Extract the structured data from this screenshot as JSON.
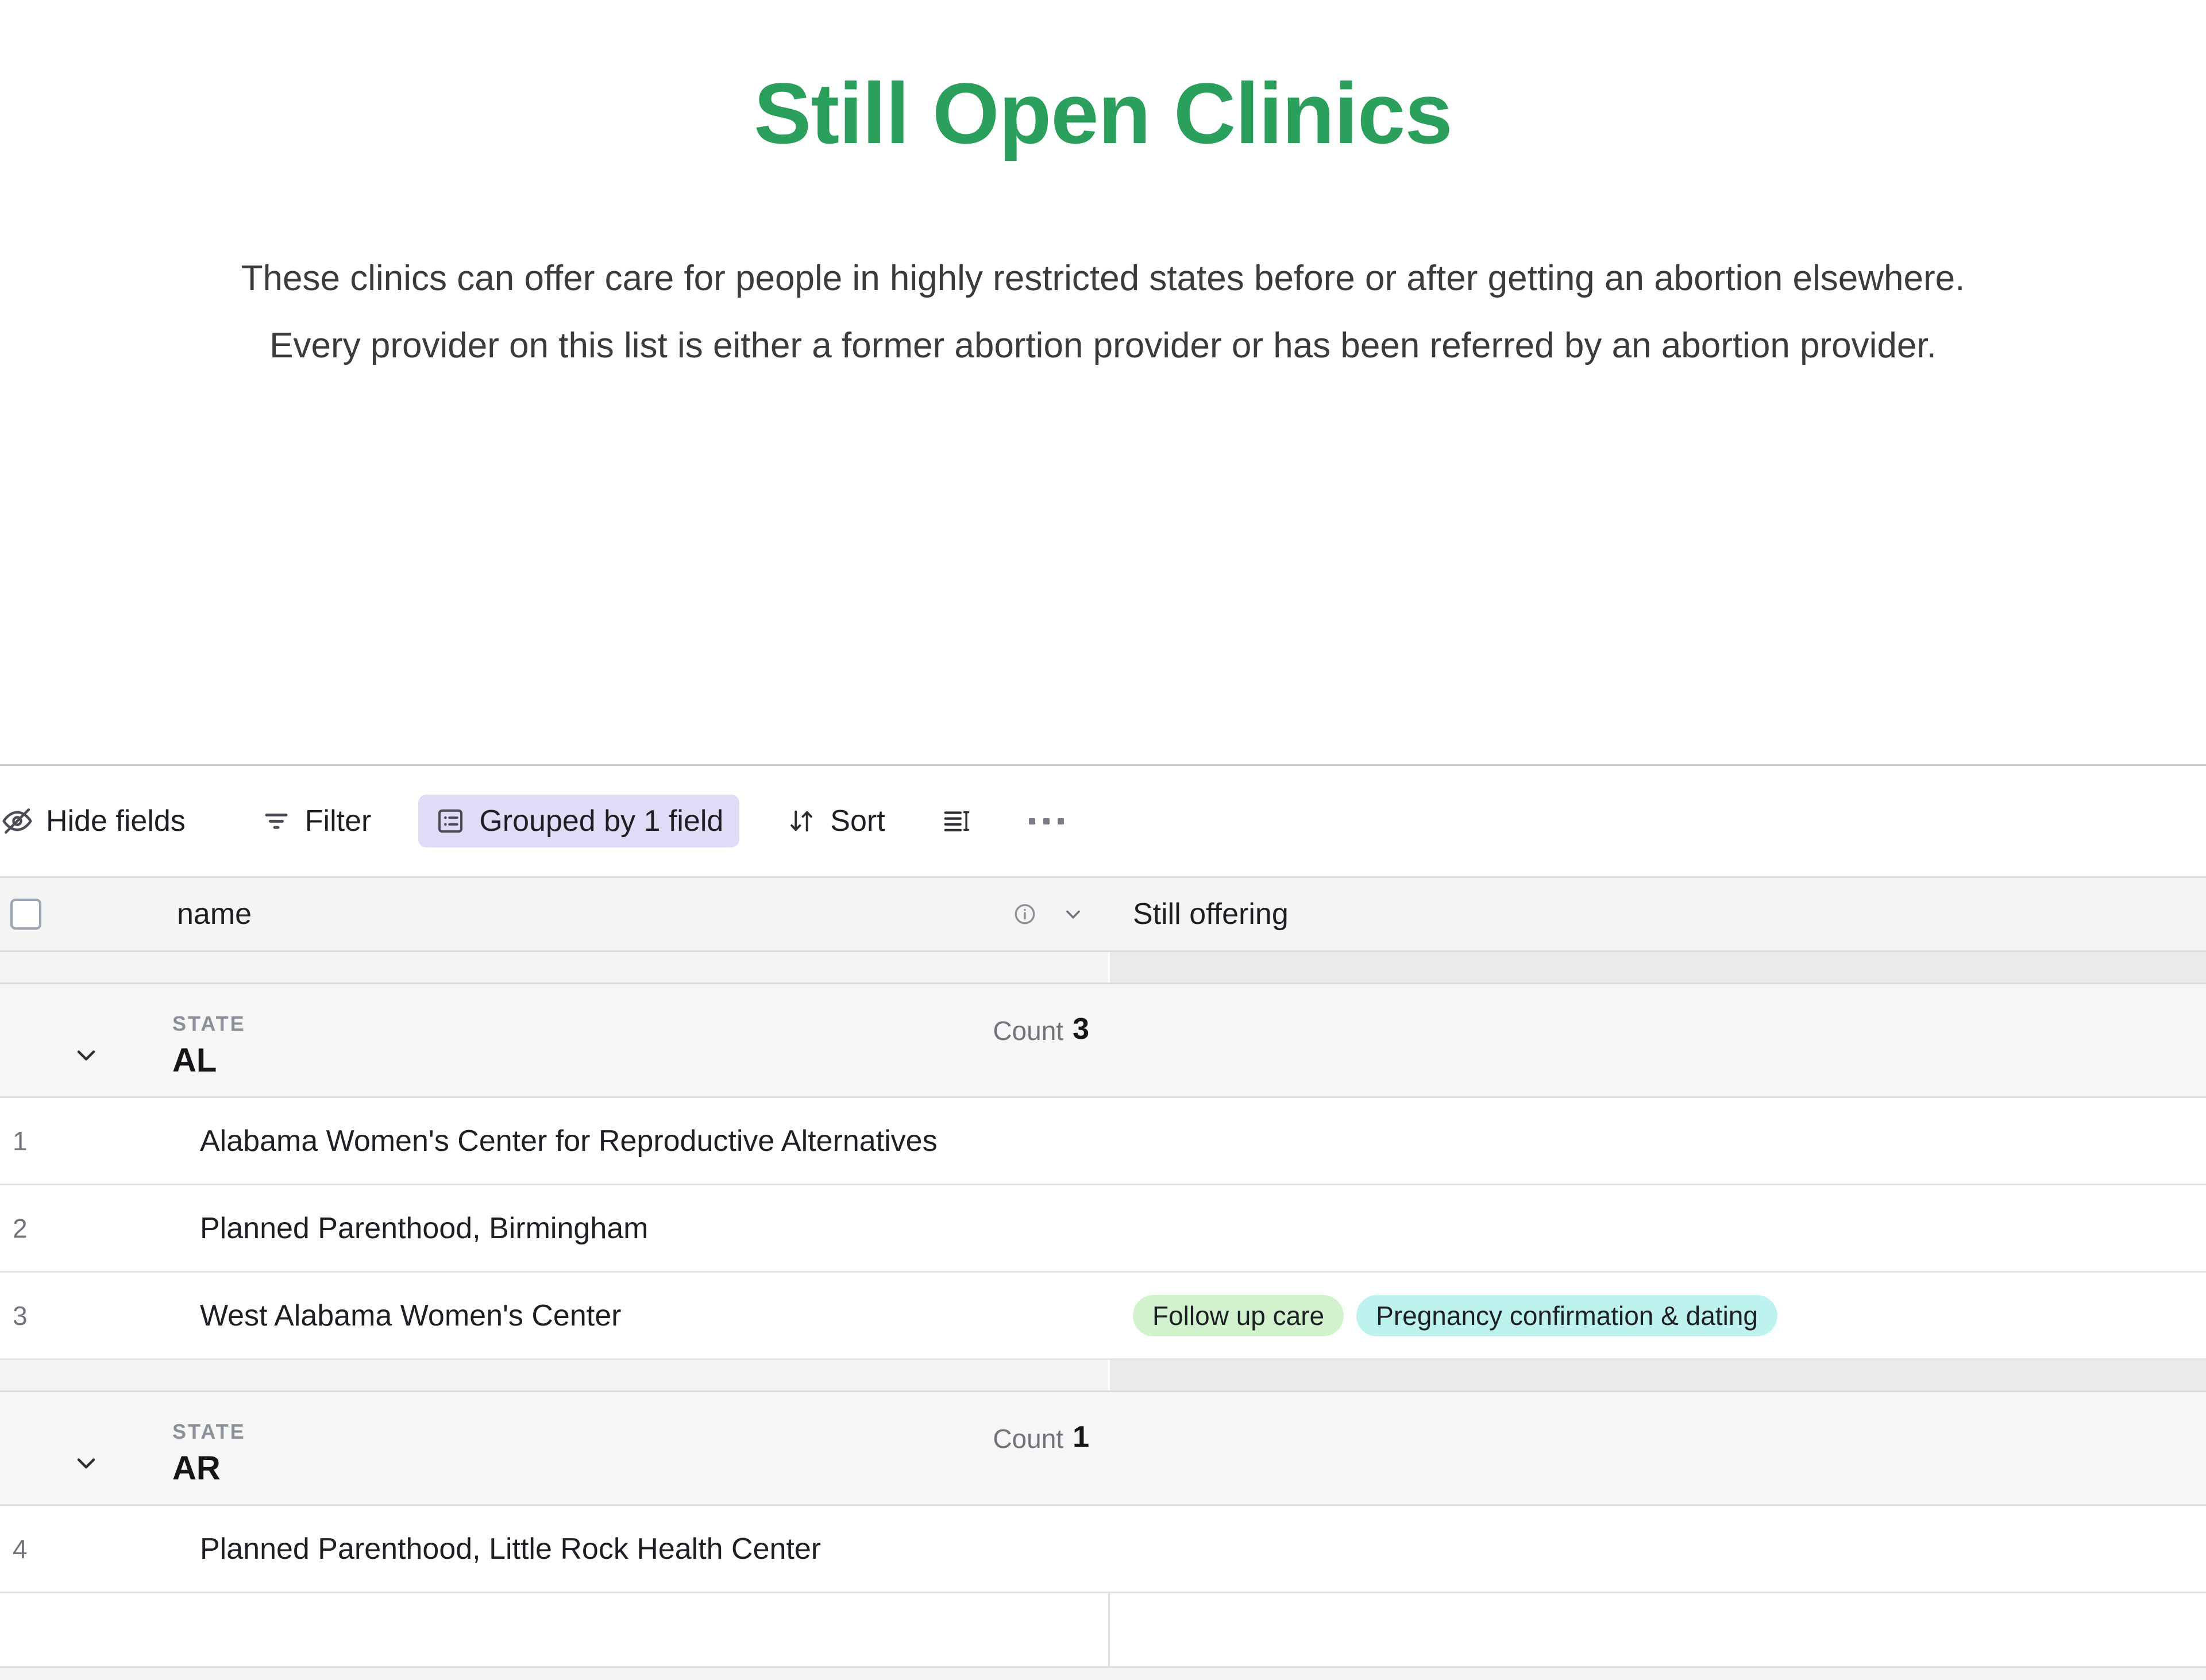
{
  "hero": {
    "title": "Still Open Clinics",
    "description": "These clinics can offer care for people in highly restricted states before or after getting an abortion elsewhere. Every provider on this list is either a former abortion provider or has been referred by an abortion provider.",
    "title_color": "#2ba05c"
  },
  "toolbar": {
    "hide_fields_label": "Hide fields",
    "filter_label": "Filter",
    "group_label": "Grouped by 1 field",
    "group_active_bg": "#e0dcf8",
    "sort_label": "Sort",
    "row_height_label": "",
    "more_label": "…"
  },
  "table": {
    "columns": [
      {
        "key": "name",
        "label": "name"
      },
      {
        "key": "still_offering",
        "label": "Still offering"
      }
    ],
    "group_field_label": "STATE",
    "count_label": "Count",
    "groups": [
      {
        "value": "AL",
        "count": "3",
        "rows": [
          {
            "num": "1",
            "name": "Alabama Women's Center for Reproductive Alternatives",
            "tags": []
          },
          {
            "num": "2",
            "name": "Planned Parenthood, Birmingham",
            "tags": []
          },
          {
            "num": "3",
            "name": "West Alabama Women's Center",
            "tags": [
              {
                "label": "Follow up care",
                "color": "#d2f2cd"
              },
              {
                "label": "Pregnancy confirmation & dating",
                "color": "#bdf2ee"
              }
            ]
          }
        ]
      },
      {
        "value": "AR",
        "count": "1",
        "rows": [
          {
            "num": "4",
            "name": "Planned Parenthood, Little Rock Health Center",
            "tags": []
          }
        ]
      }
    ]
  }
}
